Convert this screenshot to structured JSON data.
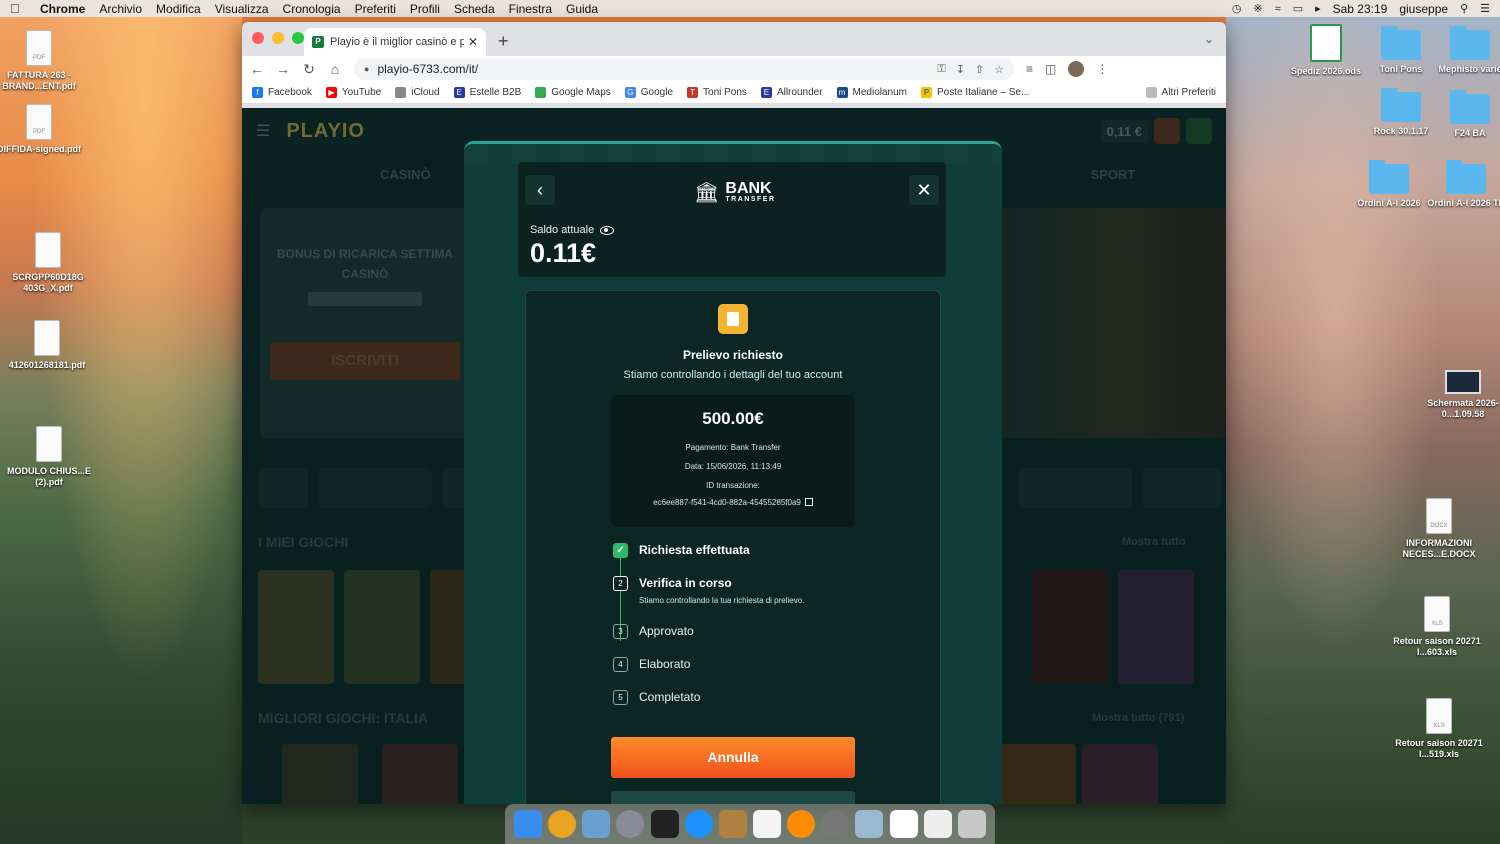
{
  "menubar": {
    "app": "Chrome",
    "items": [
      "Archivio",
      "Modifica",
      "Visualizza",
      "Cronologia",
      "Preferiti",
      "Profili",
      "Scheda",
      "Finestra",
      "Guida"
    ],
    "clock": "Sab 23:19",
    "user": "giuseppe"
  },
  "desktop_left": [
    {
      "label": "FATTURA 263 - BRAND...ENT.pdf",
      "badge": "PDF"
    },
    {
      "label": "DIFFIDA-signed.pdf",
      "badge": "PDF"
    },
    {
      "label": "SCRGPP60D18G 403G_X.pdf",
      "badge": ""
    },
    {
      "label": "412601268181.pdf",
      "badge": ""
    },
    {
      "label": "MODULO CHIUS...E (2).pdf",
      "badge": ""
    }
  ],
  "desktop_right": [
    {
      "label": "Spediz 2026.ods"
    },
    {
      "label": "Toni Pons"
    },
    {
      "label": "Mephisto varie"
    },
    {
      "label": "Rock 30.1.17"
    },
    {
      "label": "F24 BA"
    },
    {
      "label": "Ordini A-I 2026"
    },
    {
      "label": "Ordini A-I 2026 TP"
    },
    {
      "label": "Schermata 2026-0...1.09.58"
    },
    {
      "label": "INFORMAZIONI NECES...E.DOCX",
      "badge": "DOCX"
    },
    {
      "label": "Retour saison 20271 I...603.xls",
      "badge": "XLS"
    },
    {
      "label": "Retour saison 20271 I...519.xls",
      "badge": "XLS"
    }
  ],
  "browser": {
    "tab_title": "Playio è il miglior casinò e piatt",
    "url": "playio-6733.com/it/",
    "bookmarks": [
      "Facebook",
      "YouTube",
      "iCloud",
      "Estelle B2B",
      "Google Maps",
      "Google",
      "Toni Pons",
      "Allrounder",
      "Mediolanum",
      "Poste Italiane – Se..."
    ],
    "other_bookmarks": "Altri Preferiti"
  },
  "site": {
    "logo": "PLAYIO",
    "header_balance": "0,11 €",
    "nav": [
      "CASINÒ",
      "SPORT"
    ],
    "bonus_title": "BONUS DI RICARICA SETTIMA CASINÒ",
    "bonus_cta": "ISCRIVITI",
    "my_games": "I MIEI GIOCHI",
    "show_all": "Mostra tutto",
    "best_games": "MIGLIORI GIOCHI: ITALIA",
    "show_all_count": "Mostra tutto (791)"
  },
  "modal": {
    "brand_line1": "BANK",
    "brand_line2": "TRANSFER",
    "balance_label": "Saldo attuale",
    "balance_value": "0.11€",
    "request_title": "Prelievo richiesto",
    "request_subtitle": "Stiamo controllando i dettagli del tuo account",
    "amount": "500.00€",
    "payment_line": "Pagamento: Bank Transfer",
    "date_line": "Data: 15/06/2026, 11:13:49",
    "tx_label": "ID transazione:",
    "tx_id": "ec6ee887-f541-4cd0-882a-45455285f0a9",
    "steps": [
      {
        "num": "✓",
        "label": "Richiesta effettuata",
        "state": "done"
      },
      {
        "num": "2",
        "label": "Verifica in corso",
        "state": "active",
        "desc": "Stiamo controllando la tua richiesta di prelievo."
      },
      {
        "num": "3",
        "label": "Approvato",
        "state": "pending"
      },
      {
        "num": "4",
        "label": "Elaborato",
        "state": "pending"
      },
      {
        "num": "5",
        "label": "Completato",
        "state": "pending"
      }
    ],
    "cancel_label": "Annulla"
  },
  "colors": {
    "accent_orange": "#f0521e",
    "success_green": "#2dbb6a",
    "modal_bg": "#0f3d3a"
  }
}
